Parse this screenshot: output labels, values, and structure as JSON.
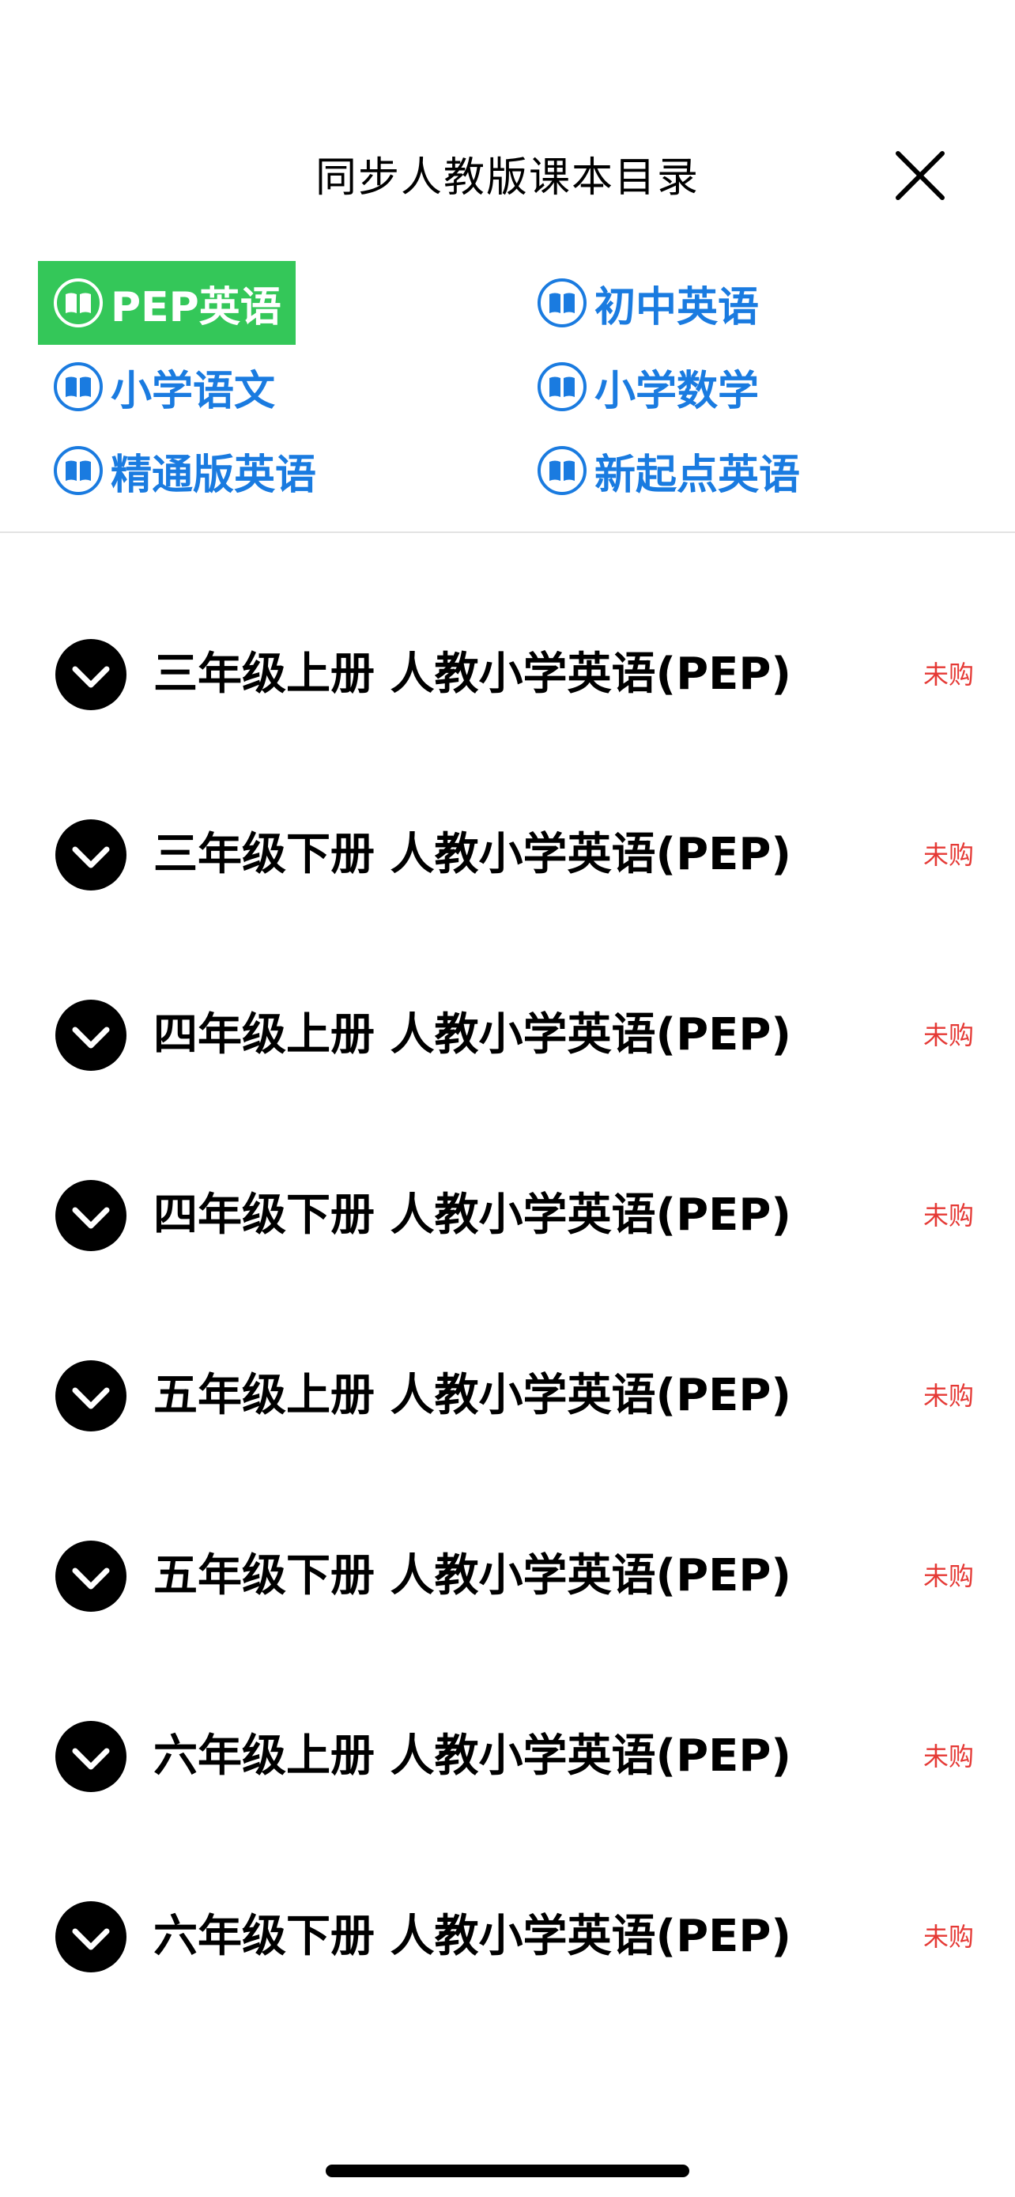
{
  "header": {
    "title": "同步人教版课本目录"
  },
  "categories": [
    {
      "label": "PEP英语",
      "active": true
    },
    {
      "label": "初中英语",
      "active": false
    },
    {
      "label": "小学语文",
      "active": false
    },
    {
      "label": "小学数学",
      "active": false
    },
    {
      "label": "精通版英语",
      "active": false
    },
    {
      "label": "新起点英语",
      "active": false
    }
  ],
  "books": [
    {
      "title": "三年级上册 人教小学英语(PEP)",
      "status": "未购"
    },
    {
      "title": "三年级下册 人教小学英语(PEP)",
      "status": "未购"
    },
    {
      "title": "四年级上册 人教小学英语(PEP)",
      "status": "未购"
    },
    {
      "title": "四年级下册 人教小学英语(PEP)",
      "status": "未购"
    },
    {
      "title": "五年级上册 人教小学英语(PEP)",
      "status": "未购"
    },
    {
      "title": "五年级下册 人教小学英语(PEP)",
      "status": "未购"
    },
    {
      "title": "六年级上册 人教小学英语(PEP)",
      "status": "未购"
    },
    {
      "title": "六年级下册 人教小学英语(PEP)",
      "status": "未购"
    }
  ],
  "icons": {
    "close": "close-icon",
    "category": "book-icon",
    "expand": "chevron-down-icon"
  },
  "colors": {
    "active_bg": "#34c759",
    "link": "#1a7be0",
    "status": "#e53935"
  }
}
